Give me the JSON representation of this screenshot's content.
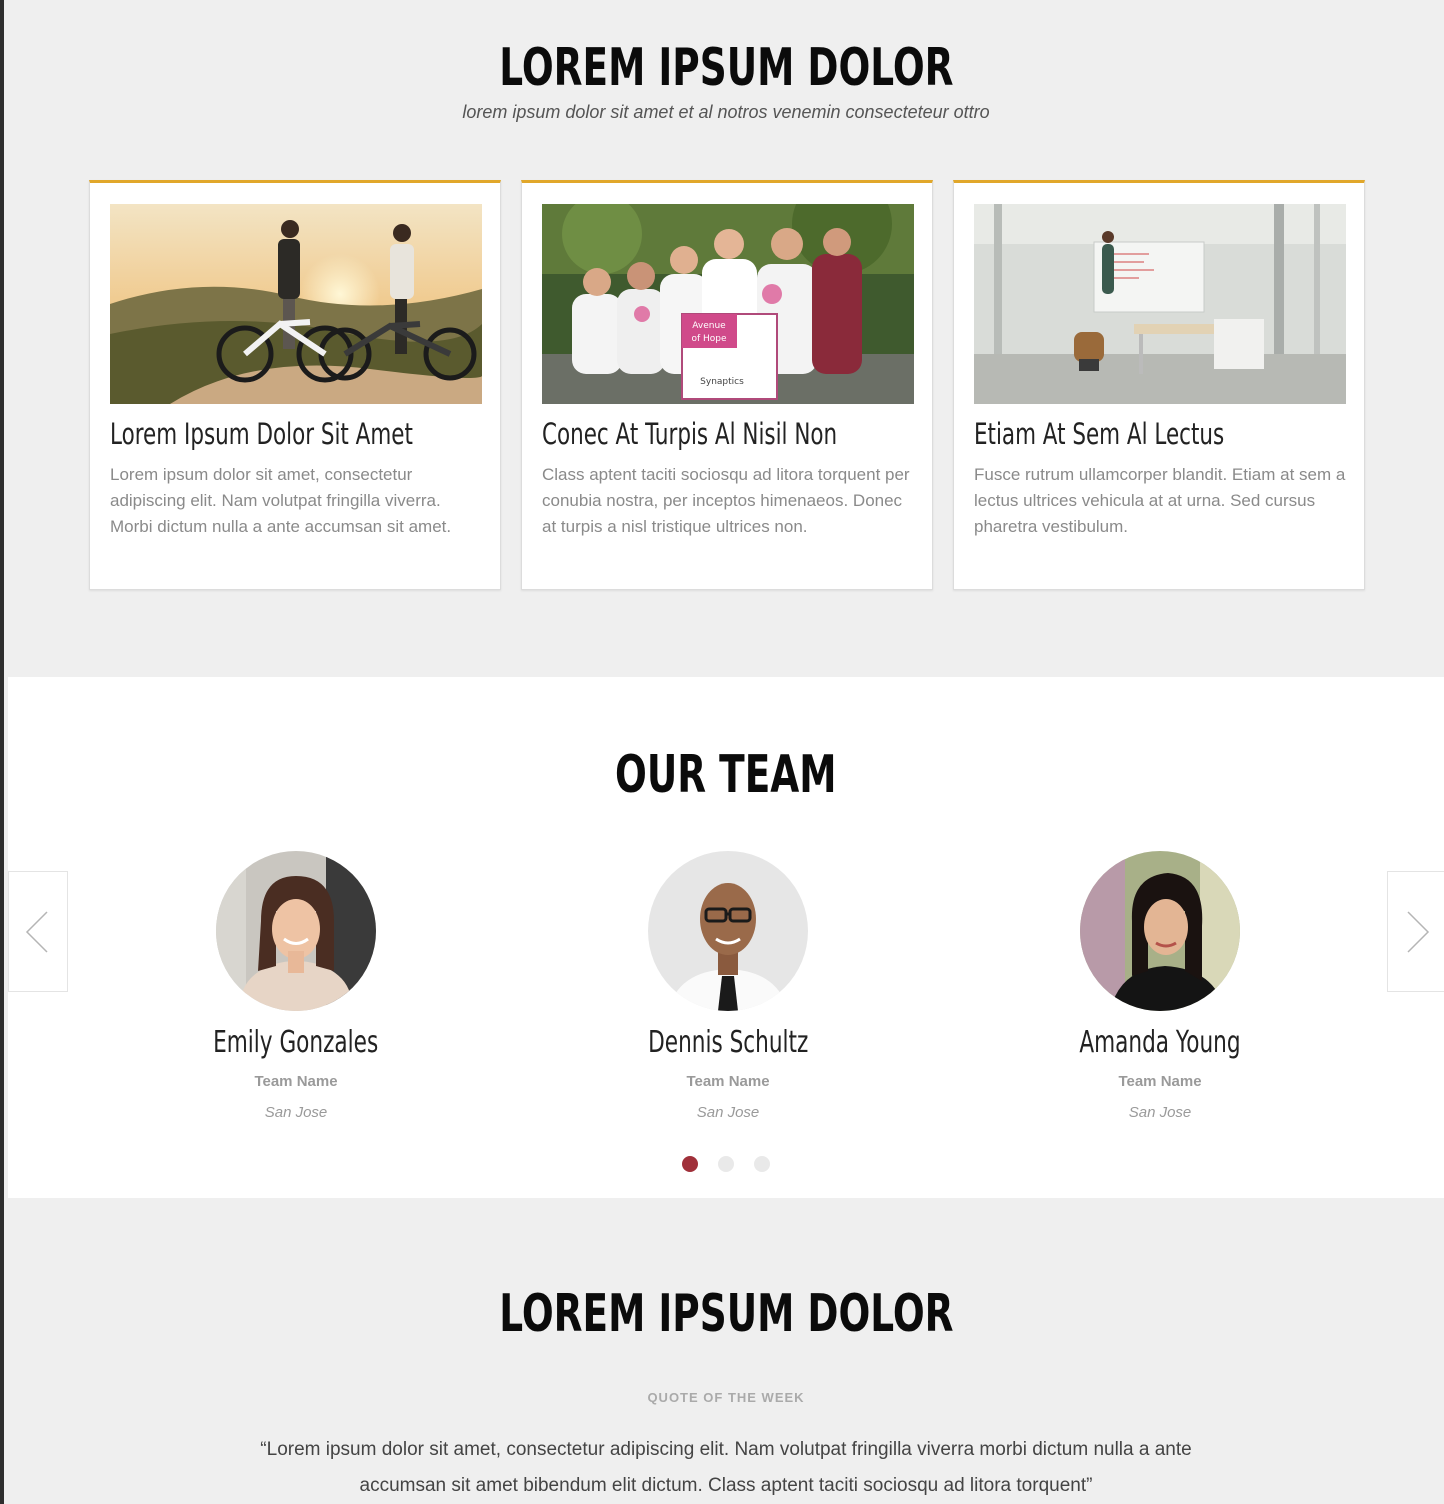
{
  "section1": {
    "title": "LOREM IPSUM DOLOR",
    "subtitle": "lorem ipsum dolor sit amet et al notros venemin consecteteur ottro",
    "accent_color": "#e1a72a",
    "cards": [
      {
        "title": "Lorem Ipsum Dolor Sit Amet",
        "text": "Lorem ipsum dolor sit amet, consectetur adipiscing elit. Nam volutpat fringilla viverra. Morbi dictum nulla a ante accumsan sit amet.",
        "image": "cyclists-sunset-photo"
      },
      {
        "title": "Conec At Turpis Al Nisil Non",
        "text": "Class aptent taciti sociosqu ad litora torquent per conubia nostra, per inceptos himenaeos. Donec at turpis a nisl tristique ultrices non.",
        "image": "charity-walk-group-photo",
        "sign_line1": "Avenue",
        "sign_line2": "of Hope",
        "sign_sponsor": "Synaptics"
      },
      {
        "title": "Etiam At Sem Al Lectus",
        "text": "Fusce rutrum ullamcorper blandit. Etiam at sem a lectus ultrices vehicula at at urna. Sed cursus pharetra vestibulum.",
        "image": "office-whiteboard-photo"
      }
    ]
  },
  "team": {
    "title": "OUR TEAM",
    "prev_icon": "chevron-left-icon",
    "next_icon": "chevron-right-icon",
    "members": [
      {
        "name": "Emily Gonzales",
        "team": "Team Name",
        "location": "San Jose"
      },
      {
        "name": "Dennis Schultz",
        "team": "Team Name",
        "location": "San Jose"
      },
      {
        "name": "Amanda Young",
        "team": "Team Name",
        "location": "San Jose"
      }
    ],
    "active_dot_color": "#a0303a",
    "active_slide": 1,
    "slide_count": 3
  },
  "section3": {
    "title": "LOREM IPSUM DOLOR",
    "quote_label": "QUOTE OF THE WEEK",
    "quote": "“Lorem ipsum dolor sit amet, consectetur adipiscing elit. Nam volutpat fringilla viverra morbi dictum nulla a ante accumsan sit amet bibendum elit dictum. Class aptent taciti sociosqu ad litora torquent”"
  }
}
